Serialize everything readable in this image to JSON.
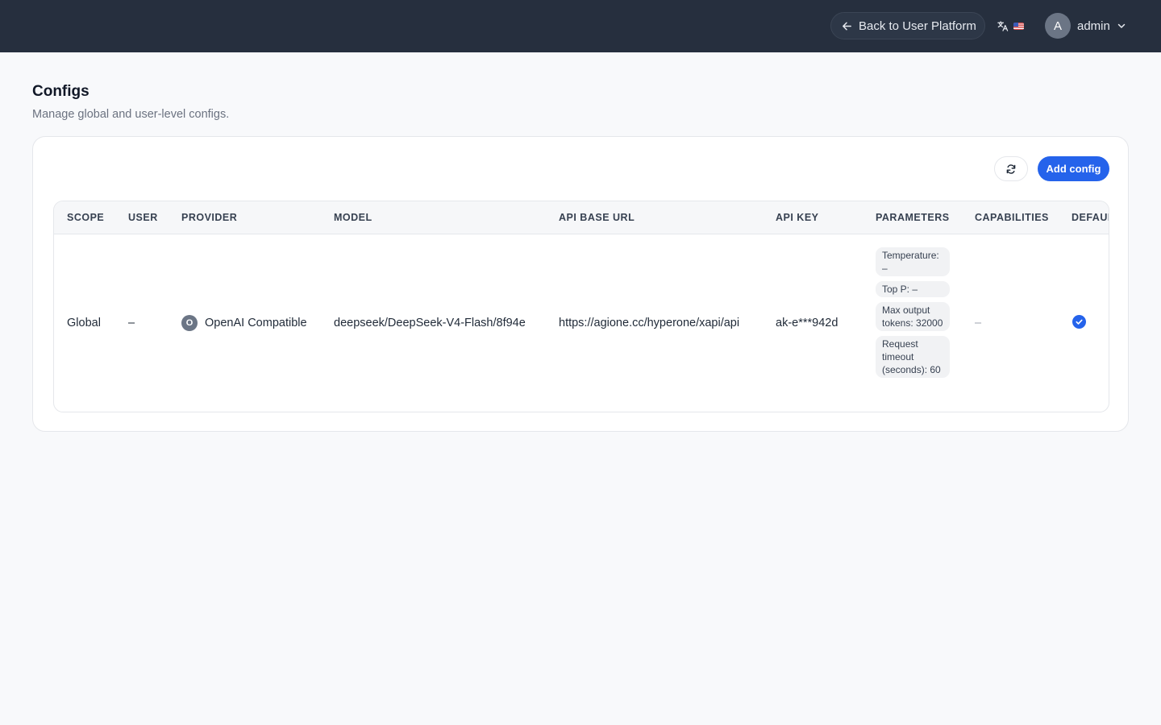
{
  "header": {
    "back_label": "Back to User Platform",
    "user_initial": "A",
    "username": "admin"
  },
  "page": {
    "title": "Configs",
    "subtitle": "Manage global and user-level configs."
  },
  "toolbar": {
    "add_label": "Add config"
  },
  "table": {
    "columns": [
      "SCOPE",
      "USER",
      "PROVIDER",
      "MODEL",
      "API BASE URL",
      "API KEY",
      "PARAMETERS",
      "CAPABILITIES",
      "DEFAUL"
    ],
    "rows": [
      {
        "scope": "Global",
        "user": "–",
        "provider_initial": "O",
        "provider": "OpenAI Compatible",
        "model": "deepseek/DeepSeek-V4-Flash/8f94e",
        "api_base_url": "https://agione.cc/hyperone/xapi/api",
        "api_key": "ak-e***942d",
        "parameters": [
          "Temperature: –",
          "Top P: –",
          "Max output tokens: 32000",
          "Request timeout (seconds): 60"
        ],
        "capabilities": "–",
        "default": true
      }
    ]
  },
  "colors": {
    "topbar": "#262f3e",
    "accent": "#2563eb"
  }
}
